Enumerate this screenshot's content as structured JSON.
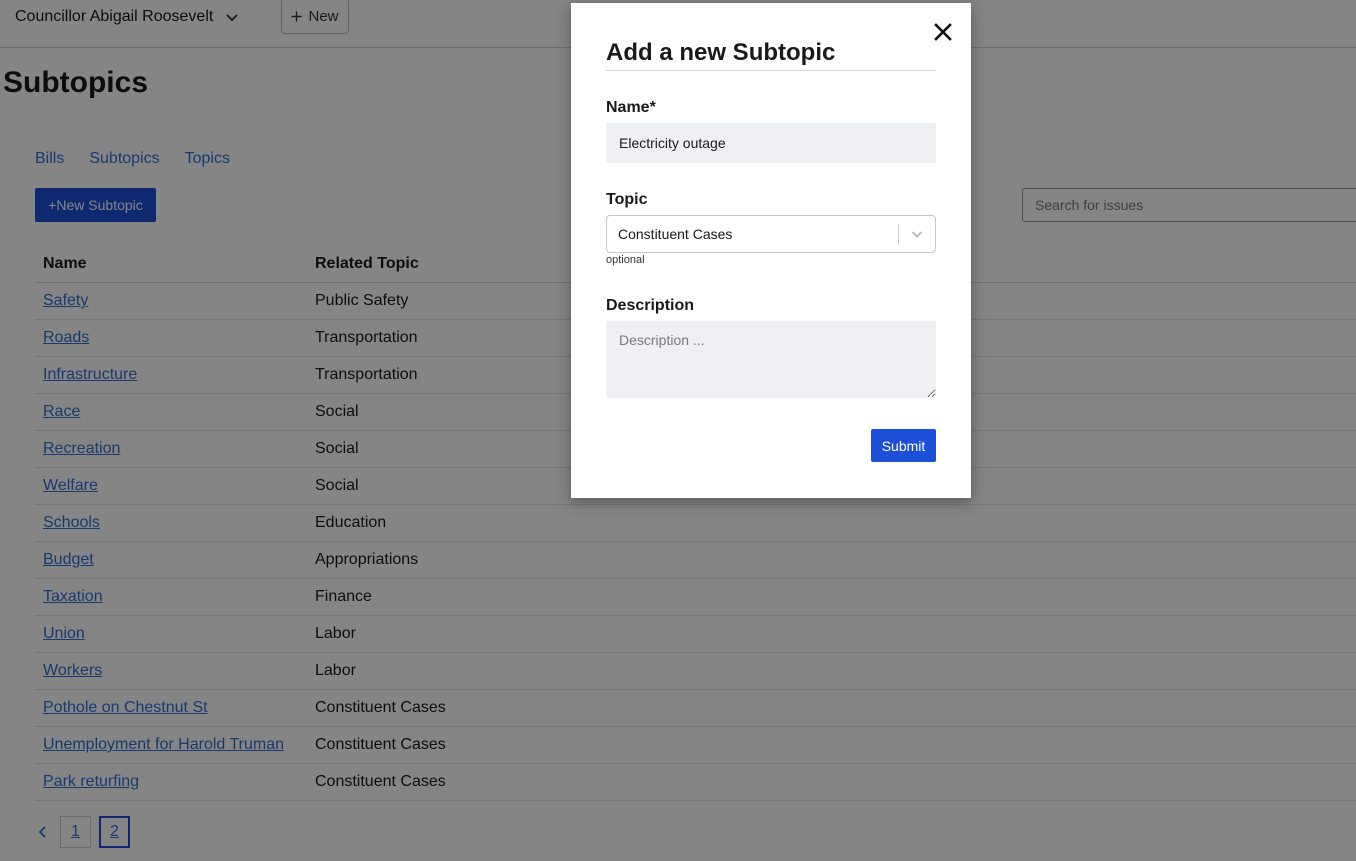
{
  "header": {
    "user_name": "Councillor Abigail Roosevelt",
    "new_label": "New"
  },
  "page": {
    "title": "Subtopics"
  },
  "tabs": [
    {
      "label": "Bills"
    },
    {
      "label": "Subtopics"
    },
    {
      "label": "Topics"
    }
  ],
  "actions": {
    "new_subtopic_label": "+New Subtopic"
  },
  "search": {
    "placeholder": "Search for issues"
  },
  "table": {
    "headers": {
      "name": "Name",
      "topic": "Related Topic"
    },
    "rows": [
      {
        "name": "Safety",
        "topic": "Public Safety"
      },
      {
        "name": "Roads",
        "topic": "Transportation"
      },
      {
        "name": "Infrastructure",
        "topic": "Transportation"
      },
      {
        "name": "Race",
        "topic": "Social"
      },
      {
        "name": "Recreation",
        "topic": "Social"
      },
      {
        "name": "Welfare",
        "topic": "Social"
      },
      {
        "name": "Schools",
        "topic": "Education"
      },
      {
        "name": "Budget",
        "topic": "Appropriations"
      },
      {
        "name": "Taxation",
        "topic": "Finance"
      },
      {
        "name": "Union",
        "topic": "Labor"
      },
      {
        "name": "Workers",
        "topic": "Labor"
      },
      {
        "name": "Pothole on Chestnut St",
        "topic": "Constituent Cases"
      },
      {
        "name": "Unemployment for Harold Truman",
        "topic": "Constituent Cases"
      },
      {
        "name": "Park returfing",
        "topic": "Constituent Cases"
      }
    ]
  },
  "pagination": {
    "prev_label": "‹",
    "pages": [
      "1",
      "2"
    ],
    "current": "2"
  },
  "modal": {
    "title": "Add a new Subtopic",
    "name_label": "Name*",
    "name_value": "Electricity outage",
    "topic_label": "Topic",
    "topic_value": "Constituent Cases",
    "topic_hint": "optional",
    "description_label": "Description",
    "description_placeholder": "Description ...",
    "submit_label": "Submit"
  },
  "colors": {
    "accent": "#1d4fd8",
    "link": "#2f6fd0",
    "overlay": "rgba(0,0,0,0.48)"
  },
  "icons": {
    "user_menu": "chevron-down-icon",
    "new": "plus-icon",
    "close": "close-icon",
    "select": "chevron-down-icon"
  }
}
